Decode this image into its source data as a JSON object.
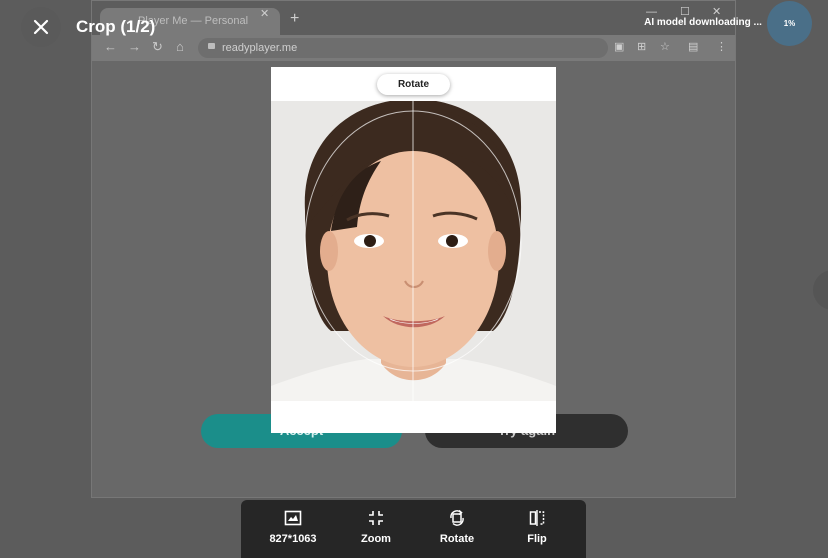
{
  "header": {
    "title": "Crop (1/2)",
    "close_icon": "close-icon"
  },
  "download": {
    "status_text": "AI model downloading ...",
    "progress_label": "1%",
    "progress": 0.01
  },
  "background_browser": {
    "tab_title": "Player Me — Personal",
    "url": "readyplayer.me",
    "buttons": {
      "accept": "Accept",
      "try_again": "Try again"
    }
  },
  "crop": {
    "rotate_chip": "Rotate"
  },
  "toolbar": {
    "items": [
      {
        "icon": "aspect-ratio-icon",
        "label": "827*1063"
      },
      {
        "icon": "zoom-icon",
        "label": "Zoom"
      },
      {
        "icon": "rotate-icon",
        "label": "Rotate"
      },
      {
        "icon": "flip-icon",
        "label": "Flip"
      }
    ]
  },
  "colors": {
    "accent_teal": "#1b8e8a",
    "overlay_dark": "#262626",
    "progress_blue": "#4a6f88"
  }
}
